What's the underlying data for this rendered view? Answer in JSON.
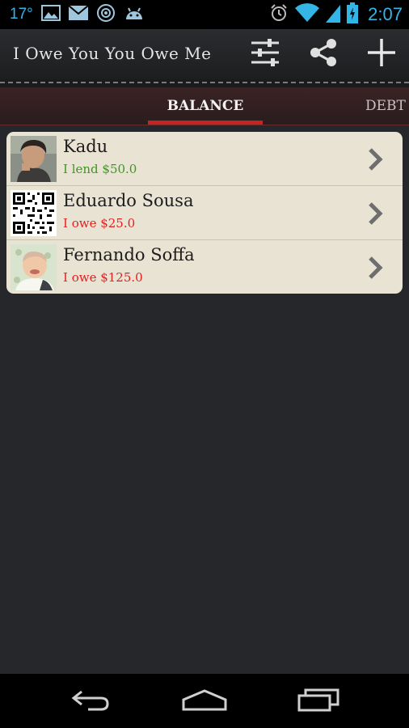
{
  "status_bar": {
    "temperature": "17°",
    "time": "2:07",
    "icons": [
      "gallery-icon",
      "gmail-icon",
      "compass-icon",
      "android-icon",
      "alarm-icon",
      "wifi-icon",
      "signal-icon",
      "battery-icon"
    ],
    "color": "#33b5e5"
  },
  "action_bar": {
    "title": "I Owe You You Owe Me",
    "actions": [
      "settings-sliders-icon",
      "share-icon",
      "add-icon"
    ]
  },
  "tabs": [
    {
      "label": "BALANCE",
      "active": true
    },
    {
      "label": "DEBT",
      "active": false
    }
  ],
  "contacts": [
    {
      "name": "Kadu",
      "status": "I lend $50.0",
      "status_color": "#3a9a1c",
      "avatar": "photo"
    },
    {
      "name": "Eduardo Sousa",
      "status": "I owe $25.0",
      "status_color": "#e32020",
      "avatar": "qr-code"
    },
    {
      "name": "Fernando Soffa",
      "status": "I owe $125.0",
      "status_color": "#e32020",
      "avatar": "baby-photo"
    }
  ],
  "nav_bar": {
    "buttons": [
      "back-icon",
      "home-icon",
      "recents-icon"
    ]
  }
}
